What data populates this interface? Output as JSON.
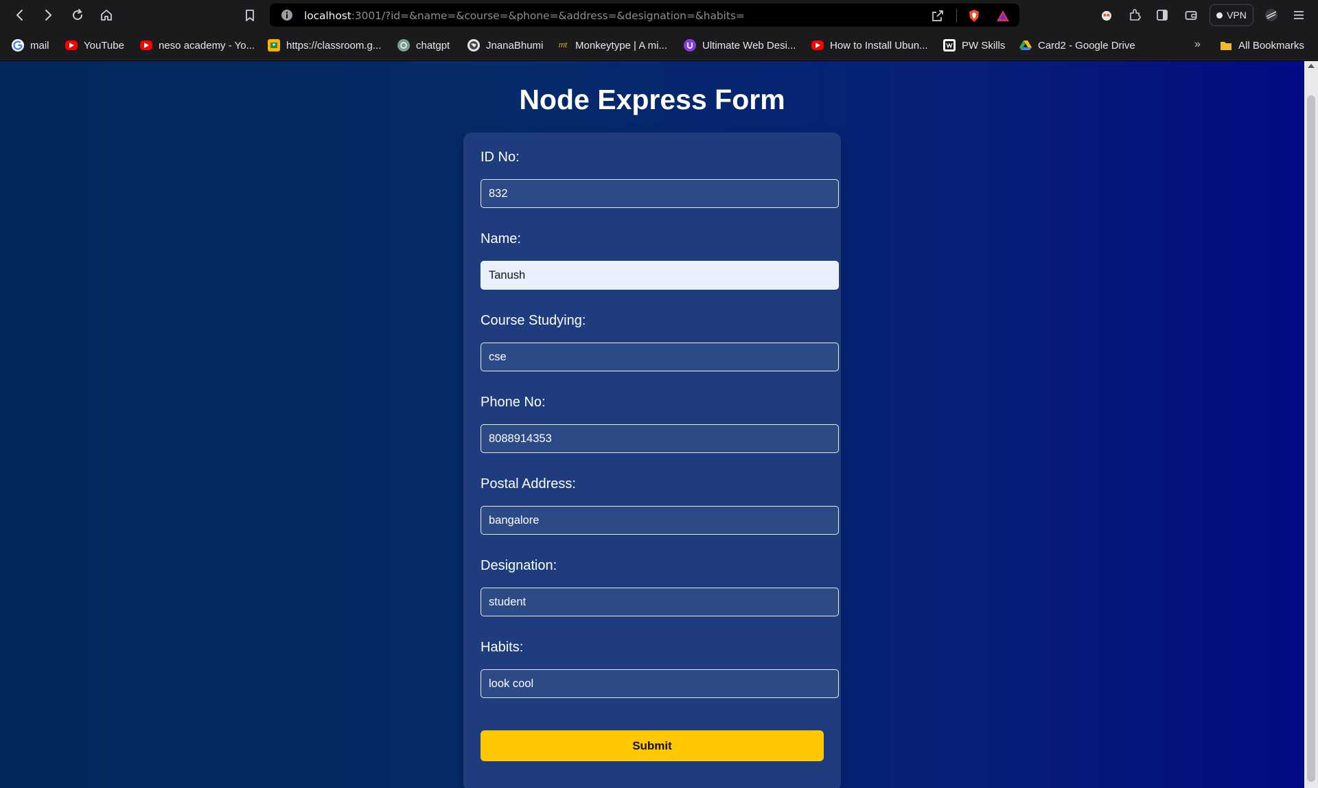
{
  "browser": {
    "url_host": "localhost",
    "url_rest": ":3001/?id=&name=&course=&phone=&address=&designation=&habits=",
    "vpn_label": "VPN"
  },
  "bookmarks": {
    "items": [
      {
        "label": "mail",
        "icon": "google-icon"
      },
      {
        "label": "YouTube",
        "icon": "youtube-icon"
      },
      {
        "label": "neso academy - Yo...",
        "icon": "youtube-icon"
      },
      {
        "label": "https://classroom.g...",
        "icon": "classroom-icon"
      },
      {
        "label": "chatgpt",
        "icon": "chatgpt-icon"
      },
      {
        "label": "JnanaBhumi",
        "icon": "globe-icon"
      },
      {
        "label": "Monkeytype | A mi...",
        "icon": "monkeytype-icon"
      },
      {
        "label": "Ultimate Web Desi...",
        "icon": "udemy-icon"
      },
      {
        "label": "How to Install Ubun...",
        "icon": "youtube-icon"
      },
      {
        "label": "PW Skills",
        "icon": "pw-icon"
      },
      {
        "label": "Card2 - Google Drive",
        "icon": "drive-icon"
      }
    ],
    "overflow": "»",
    "all_bookmarks": "All Bookmarks"
  },
  "form": {
    "title": "Node Express Form",
    "fields": [
      {
        "label": "ID No:",
        "value": "832"
      },
      {
        "label": "Name:",
        "value": "Tanush"
      },
      {
        "label": "Course Studying:",
        "value": "cse"
      },
      {
        "label": "Phone No:",
        "value": "8088914353"
      },
      {
        "label": "Postal Address:",
        "value": "bangalore"
      },
      {
        "label": "Designation:",
        "value": "student"
      },
      {
        "label": "Habits:",
        "value": "look cool"
      }
    ],
    "submit_label": "Submit"
  },
  "colors": {
    "submit_button": "#ffc800",
    "card": "#1f3d7e",
    "page_gradient_start": "#03285a",
    "page_gradient_end": "#040a82"
  }
}
